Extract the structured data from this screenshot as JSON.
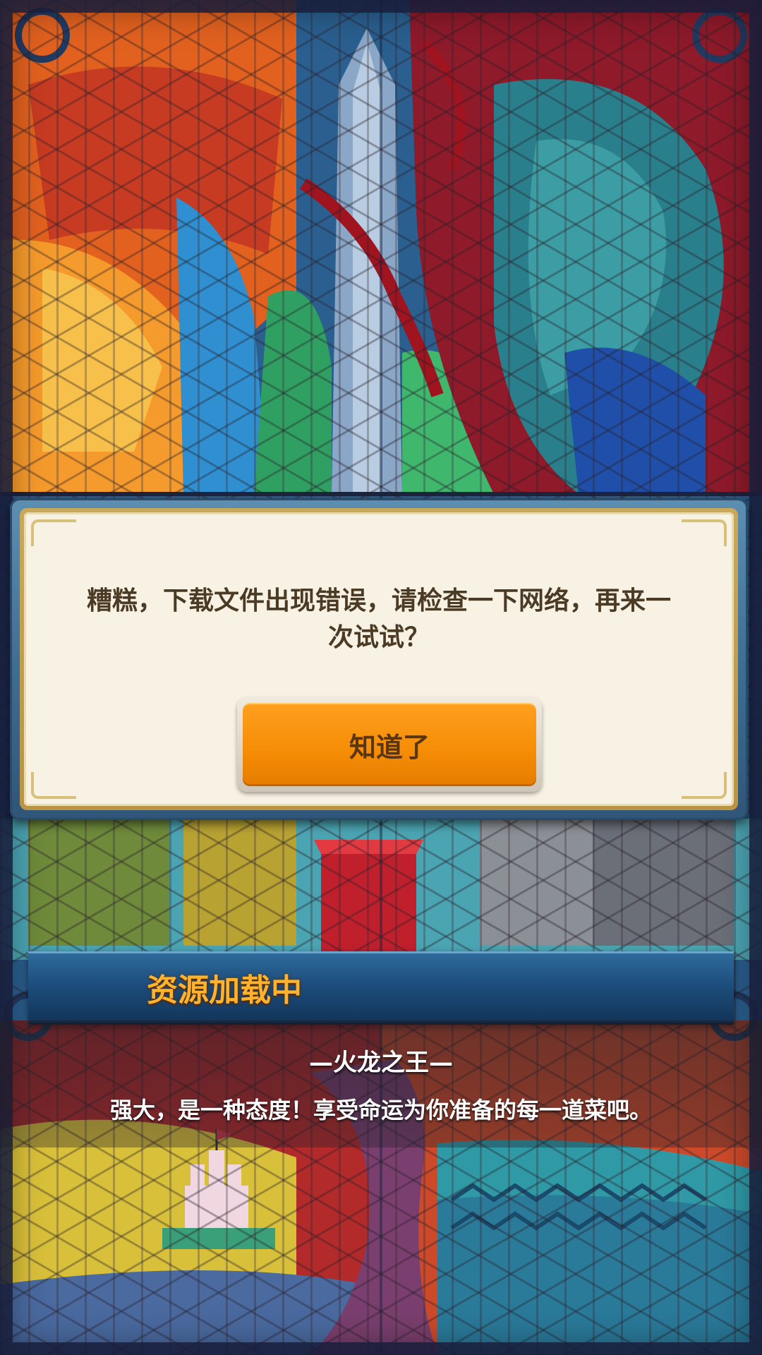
{
  "dialog": {
    "message": "糟糕，下载文件出现错误，请检查一下网络，再来一次试试？",
    "ok_label": "知道了"
  },
  "loading": {
    "label": "资源加载中"
  },
  "quote": {
    "author": "—火龙之王—",
    "text": "强大，是一种态度！享受命运为你准备的每一道菜吧。"
  },
  "colors": {
    "dialog_border": "#3f6f95",
    "dialog_paper": "#f7f2e3",
    "button_orange": "#f58c05",
    "loading_text": "#ffb22c"
  },
  "icons": [
    "sword-icon",
    "castle-icon",
    "dragon-wing-icon"
  ]
}
